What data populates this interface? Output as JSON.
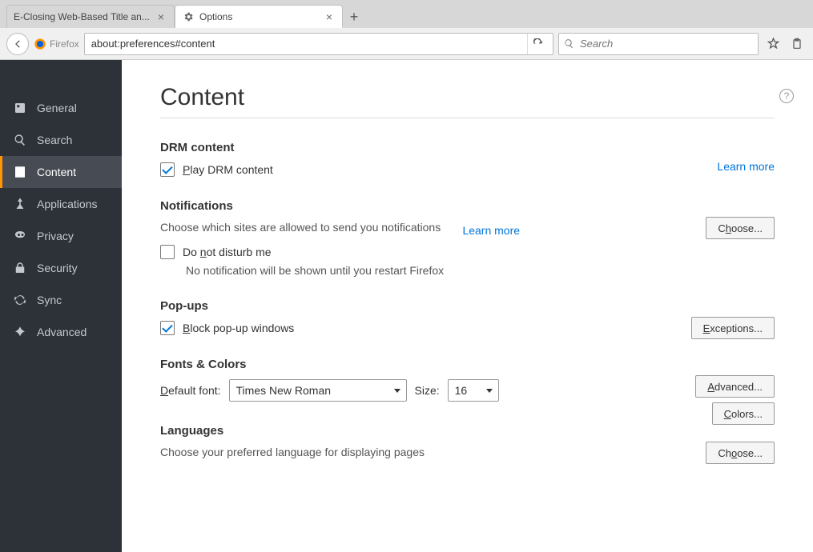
{
  "tabs": [
    {
      "title": "E-Closing Web-Based Title an..."
    },
    {
      "title": "Options"
    }
  ],
  "nav": {
    "brand": "Firefox",
    "url": "about:preferences#content",
    "search_placeholder": "Search"
  },
  "sidebar": {
    "items": [
      {
        "id": "general",
        "label": "General"
      },
      {
        "id": "search",
        "label": "Search"
      },
      {
        "id": "content",
        "label": "Content"
      },
      {
        "id": "applications",
        "label": "Applications"
      },
      {
        "id": "privacy",
        "label": "Privacy"
      },
      {
        "id": "security",
        "label": "Security"
      },
      {
        "id": "sync",
        "label": "Sync"
      },
      {
        "id": "advanced",
        "label": "Advanced"
      }
    ]
  },
  "page": {
    "title": "Content",
    "drm": {
      "heading": "DRM content",
      "play_label": "Play DRM content",
      "learn_more": "Learn more"
    },
    "notifications": {
      "heading": "Notifications",
      "desc": "Choose which sites are allowed to send you notifications",
      "learn_more": "Learn more",
      "choose_btn": "Choose...",
      "dnd_label": "Do not disturb me",
      "dnd_note": "No notification will be shown until you restart Firefox"
    },
    "popups": {
      "heading": "Pop-ups",
      "block_label": "Block pop-up windows",
      "exceptions_btn": "Exceptions..."
    },
    "fonts": {
      "heading": "Fonts & Colors",
      "default_font_label": "Default font:",
      "default_font_value": "Times New Roman",
      "size_label": "Size:",
      "size_value": "16",
      "advanced_btn": "Advanced...",
      "colors_btn": "Colors..."
    },
    "languages": {
      "heading": "Languages",
      "desc": "Choose your preferred language for displaying pages",
      "choose_btn": "Choose..."
    }
  }
}
